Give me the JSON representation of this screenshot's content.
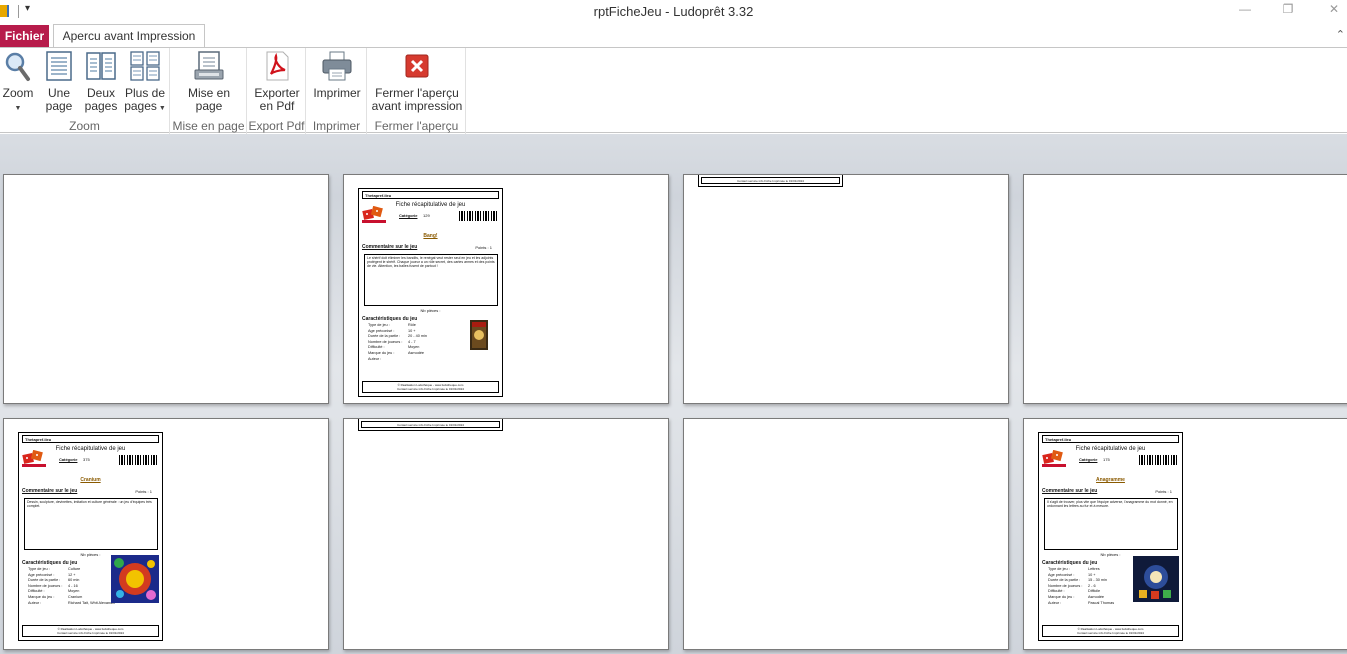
{
  "window": {
    "title": "rptFicheJeu  -  Ludoprêt 3.32",
    "qat_symbol": "▾",
    "minimize": "—",
    "restore": "❐",
    "close": "✕"
  },
  "tabs": {
    "file": "Fichier",
    "preview": "Apercu avant Impression",
    "collapse": "⌃"
  },
  "ribbon": {
    "zoom_group": {
      "label": "Zoom",
      "zoom": "Zoom",
      "one_page_1": "Une",
      "one_page_2": "page",
      "two_pages_1": "Deux",
      "two_pages_2": "pages",
      "more_pages_1": "Plus de",
      "more_pages_2": "pages"
    },
    "layout_group": {
      "label": "Mise en page",
      "btn_1": "Mise en",
      "btn_2": "page"
    },
    "pdf_group": {
      "label": "Export Pdf",
      "btn_1": "Exporter",
      "btn_2": "en Pdf"
    },
    "print_group": {
      "label": "Imprimer",
      "btn": "Imprimer"
    },
    "close_group": {
      "label": "Fermer l'aperçu",
      "btn_1": "Fermer l'aperçu",
      "btn_2": "avant impression"
    }
  },
  "report": {
    "header": "Thetapref.ileu",
    "title": "Fiche récapitulative de jeu",
    "category_label": "Catégorie",
    "comment_label": "Commentaire sur le jeu",
    "points": "Points : 1",
    "pieces": "Nb pièces :",
    "features_label": "Caractéristiques du jeu",
    "keys": [
      "Type de jeu :",
      "Age préconisé :",
      "Durée de la partie :",
      "Nombre de joueurs :",
      "Difficulté :",
      "Marque du jeu :",
      "Auteur :"
    ],
    "footer_1": "© Réalisation Ludothèque - www.ludotheque.com",
    "footer_2": "Contact service info    Fiche Imprimée le 01/01/2024",
    "games": [
      {
        "category_num": "129",
        "name": "Bang!",
        "comment": "Le shérif doit éliminer les bandits, le renégat veut rester seul en jeu et les adjoints protègent le shérif. Chaque joueur a un rôle secret, des cartes armes et des points de vie. Attention, les balles fusent de partout !",
        "values": [
          "Rôle",
          "10 +",
          "20 - 40 min",
          "4 - 7",
          "Moyen",
          "Asmodée",
          ""
        ]
      },
      {
        "category_num": "375",
        "name": "Cranium",
        "comment": "Dessin, sculpture, devinettes, imitation et culture générale : un jeu d'équipes très complet.",
        "values": [
          "Culture",
          "12 +",
          "60 min",
          "4 - 16",
          "Moyen",
          "Cranium",
          "Richard Tait, Whit Alexander"
        ]
      },
      {
        "category_num": "175",
        "name": "Anagramme",
        "comment": "Il s'agit de trouver, plus vite que l'équipe adverse, l'anagramme du mot donné, en ordonnant les lettres au fur et à mesure.",
        "values": [
          "Lettres",
          "10 +",
          "15 - 30 min",
          "2 - 6",
          "Difficile",
          "Asmodée",
          "Pascal Thomas"
        ]
      }
    ]
  }
}
